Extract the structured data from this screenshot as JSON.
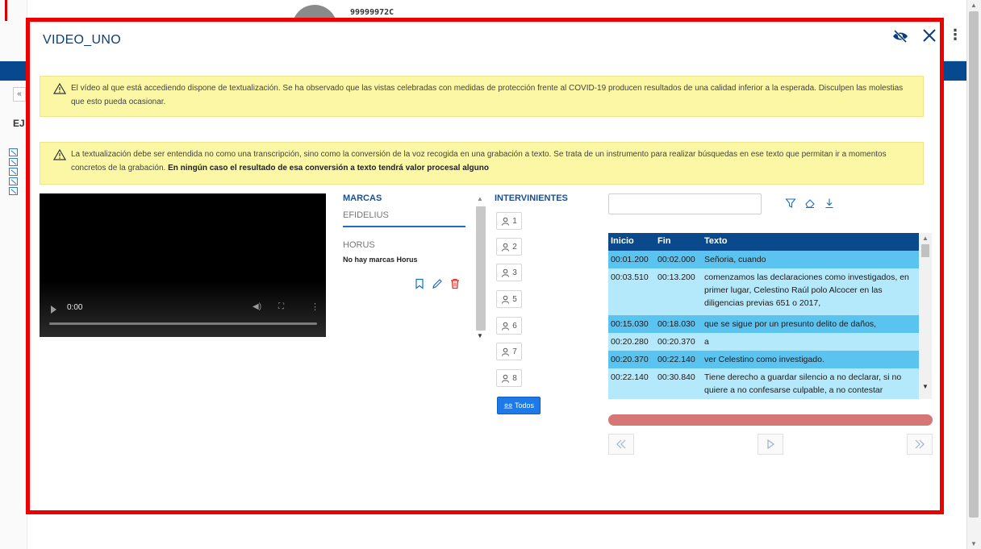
{
  "background": {
    "user_id": "99999972C",
    "section_label": "EJ",
    "back_arrow": "«"
  },
  "modal": {
    "title": "VIDEO_UNO",
    "alerts": [
      {
        "text": "El vídeo al que está accediendo dispone de textualización. Se ha observado que las vistas celebradas con medidas de protección frente al COVID-19 producen resultados de una calidad inferior a la esperada. Disculpen las molestias que esto pueda ocasionar.",
        "bold": ""
      },
      {
        "text": "La textualización debe ser entendida no como una transcripción, sino como la conversión de la voz recogida en una grabación a texto. Se trata de un instrumento para realizar búsquedas en ese texto que permitan ir a momentos concretos de la grabación.",
        "bold": "En ningún caso el resultado de esa conversión a texto tendrá valor procesal alguno"
      }
    ],
    "video": {
      "current_time": "0:00",
      "progress": 0
    },
    "marcas": {
      "title": "MARCAS",
      "tab": "EFIDELIUS",
      "horus_title": "HORUS",
      "horus_empty": "No hay marcas Horus"
    },
    "intervinientes": {
      "title": "INTERVINIENTES",
      "items": [
        "1",
        "2",
        "3",
        "5",
        "6",
        "7",
        "8"
      ],
      "todos_label": "Todos"
    },
    "search": {
      "value": "",
      "placeholder": ""
    },
    "transcript": {
      "columns": [
        "Inicio",
        "Fin",
        "Texto"
      ],
      "rows": [
        {
          "inicio": "00:01.200",
          "fin": "00:02.000",
          "texto": "Señoria, cuando",
          "tone": "dark"
        },
        {
          "inicio": "00:03.510",
          "fin": "00:13.200",
          "texto": "comenzamos las declaraciones como investigados, en primer lugar, Celestino Raúl polo Alcocer en las diligencias previas 651 o 2017,",
          "tone": "light"
        },
        {
          "inicio": "00:15.030",
          "fin": "00:18.030",
          "texto": "que se sigue por un presunto delito de daños,",
          "tone": "dark"
        },
        {
          "inicio": "00:20.280",
          "fin": "00:20.370",
          "texto": "a",
          "tone": "light"
        },
        {
          "inicio": "00:20.370",
          "fin": "00:22.140",
          "texto": "ver Celestino como investigado.",
          "tone": "dark"
        },
        {
          "inicio": "00:22.140",
          "fin": "00:30.840",
          "texto": "Tiene derecho a guardar silencio a no declarar, si no quiere a no confesarse culpable, a no contestar",
          "tone": "light"
        }
      ]
    },
    "colors": {
      "frame": "#ee0000",
      "title": "#0c3f78",
      "alert_bg": "#fbf7a5",
      "table_header": "#0a4a8c",
      "row_dark": "#5bc3ef",
      "row_light": "#b4e8fb",
      "audio_bar": "#d57775",
      "todos_button": "#1f79e8",
      "icon_blue": "#1c6dc4",
      "icon_red": "#e0302a"
    },
    "icons": [
      "eye-off-icon",
      "close-icon",
      "warning-icon",
      "bookmark-icon",
      "pencil-icon",
      "trash-icon",
      "person-icon",
      "filter-icon",
      "eraser-icon",
      "download-icon",
      "rewind-icon",
      "play-icon",
      "forward-icon"
    ]
  }
}
